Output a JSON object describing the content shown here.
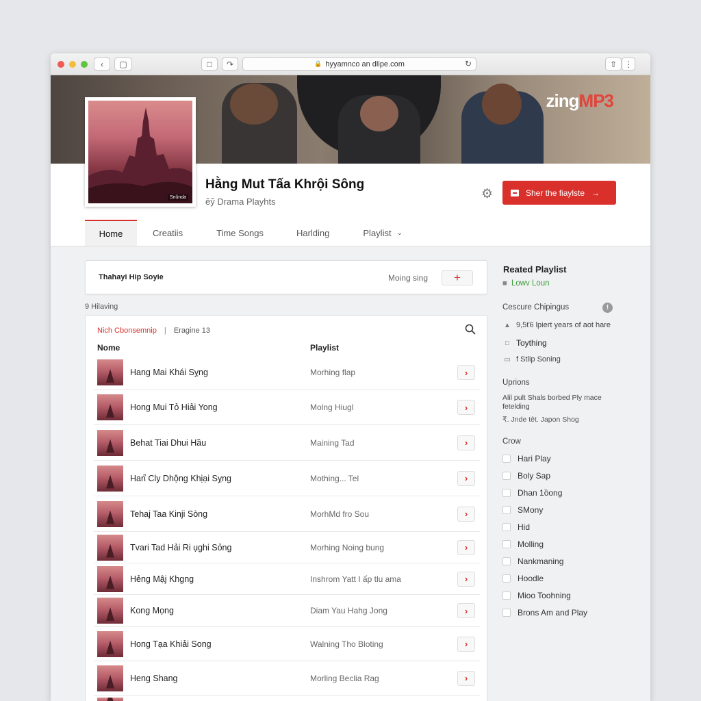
{
  "browser": {
    "url": "hyyamnco an dlipe.com"
  },
  "brand": {
    "logo_left": "zing",
    "logo_right": "MP3",
    "accent_color": "#d9302c"
  },
  "header": {
    "title": "Hằng Mut Tấa Khrội Sông",
    "subtitle": "ӗỹ Drama Playhts",
    "share_label": "Sher the fiaylste",
    "cover_tag": "Snûnda"
  },
  "tabs": [
    {
      "label": "Home",
      "active": true
    },
    {
      "label": "Creatiis",
      "active": false
    },
    {
      "label": "Time Songs",
      "active": false
    },
    {
      "label": "Harlding",
      "active": false
    },
    {
      "label": "Playlist",
      "active": false,
      "dropdown": true
    }
  ],
  "search_card": {
    "label": "Thahayi Hip Soyie",
    "right_label": "Moing sing",
    "add_symbol": "+"
  },
  "list": {
    "count_label": "9 Hilaving",
    "filter_active": "Nich Cbonsemnip",
    "filter_sep": "|",
    "filter_other": "Eragine 13",
    "col_name": "Nome",
    "col_playlist": "Playlist",
    "rows": [
      {
        "name": "Hang Mai Khái Sỵng",
        "playlist": "Morhing flap"
      },
      {
        "name": "Hong Mui Tỏ Hiải Yong",
        "playlist": "Molng Hiugl"
      },
      {
        "name": "Behat Tiai Dhui Hầu",
        "playlist": "Maining Tad"
      },
      {
        "name": "Harἳ Cly Dhộng Khịại Sỵng",
        "playlist": "Mothing... Tel"
      },
      {
        "name": "Tehaj Taa Kinji Sòng",
        "playlist": "MorhMd fro Sou"
      },
      {
        "name": "Tvari Tad Hải Ri ụghi Sỏng",
        "playlist": "Morhing Noing bung"
      },
      {
        "name": "Hẻng Mậj Khgng",
        "playlist": "Inshrom Yatt I ấp tlu ama"
      },
      {
        "name": "Kong Mọng",
        "playlist": "Diam Yau Hahg Jong"
      },
      {
        "name": "Hong Tạa Khiải Song",
        "playlist": "Walning Tho Bloting"
      },
      {
        "name": "Heng Shang",
        "playlist": "Morling Beclia Rag"
      }
    ]
  },
  "sidebar": {
    "title": "Reated Playlist",
    "sub": "Lowv Loun",
    "section1": "Cescure Chipingus",
    "info_symbol": "!",
    "line1": "9,5ť6 lpiert years of aot hare",
    "line2": "Toything",
    "line3": "f Stlip Soning",
    "section2": "Uprions",
    "para1": "Alil pult Shals borbed Ply mace fetelding",
    "para2": "₹. Jnde têt. Japon Shog",
    "section3": "Crow",
    "checkboxes": [
      "Hari Play",
      "Boly Sap",
      "Dhan 1ồong",
      "SMony",
      "Hid",
      "Molling",
      "Nankmaning",
      "Hoodle",
      "Mioo Toohning",
      "Brons Am and Play"
    ]
  }
}
